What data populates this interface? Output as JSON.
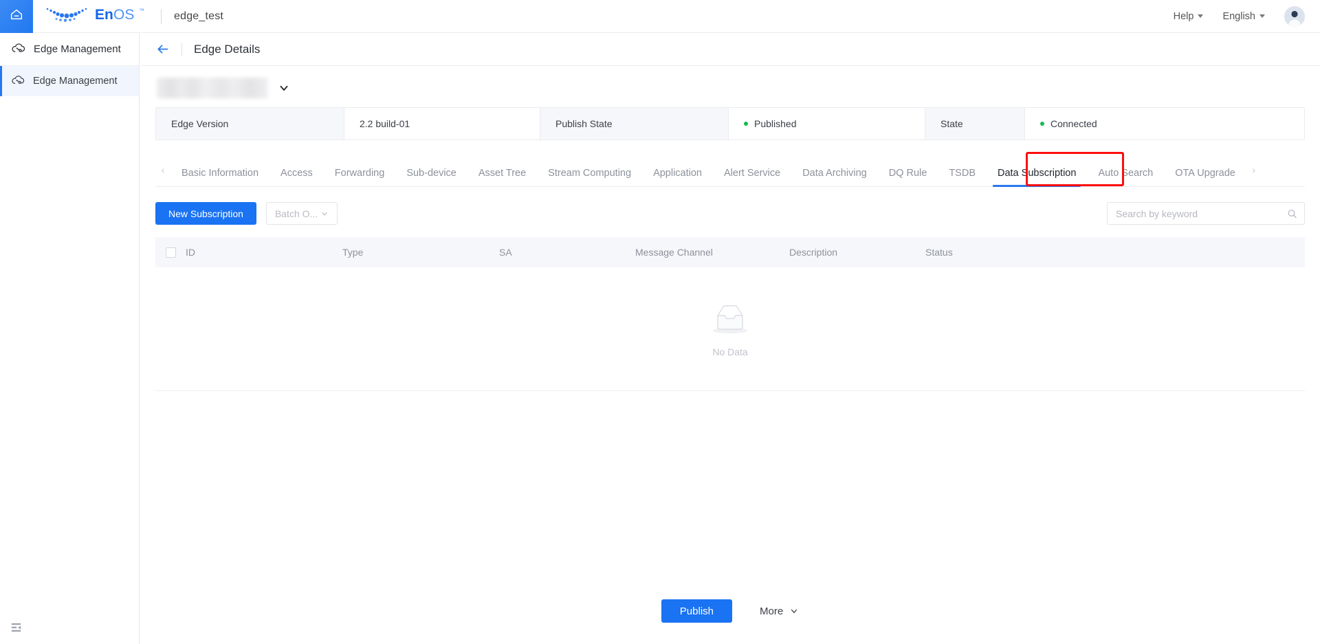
{
  "topbar": {
    "home_icon": "home-icon",
    "brand": "EnOS",
    "doc_title": "edge_test",
    "help_label": "Help",
    "language_label": "English",
    "avatar_icon": "user-avatar-icon"
  },
  "sidebar": {
    "header": {
      "label": "Edge Management",
      "icon": "edge-cloud-icon"
    },
    "items": [
      {
        "label": "Edge Management",
        "icon": "edge-cloud-icon",
        "selected": true
      }
    ],
    "collapse_icon": "sidebar-collapse-icon"
  },
  "page": {
    "back_icon": "back-arrow-icon",
    "title": "Edge Details"
  },
  "device_selector": {
    "value": "",
    "chevron_icon": "chevron-down-icon"
  },
  "info": {
    "cells": [
      {
        "label": "Edge Version",
        "value": "2.2 build-01",
        "status": null
      },
      {
        "label": "Publish State",
        "value": "Published",
        "status": "ok"
      },
      {
        "label": "State",
        "value": "Connected",
        "status": "ok"
      }
    ],
    "status_color": "#19b955"
  },
  "tabs": {
    "scroll_left_icon": "chevron-left-icon",
    "scroll_right_icon": "chevron-right-icon",
    "active": "Data Subscription",
    "highlight_color": "#fd0d0d",
    "accent_color": "#2878f0",
    "items": [
      "Basic Information",
      "Access",
      "Forwarding",
      "Sub-device",
      "Asset Tree",
      "Stream Computing",
      "Application",
      "Alert Service",
      "Data Archiving",
      "DQ Rule",
      "TSDB",
      "Data Subscription",
      "Auto Search",
      "OTA Upgrade"
    ]
  },
  "toolbar": {
    "new_subscription_label": "New Subscription",
    "batch_label": "Batch O...",
    "batch_chevron_icon": "chevron-down-icon",
    "search_placeholder": "Search by keyword",
    "search_value": "",
    "search_icon": "search-icon"
  },
  "table": {
    "select_all_checkbox": "select-all-checkbox",
    "columns": [
      "ID",
      "Type",
      "SA",
      "Message Channel",
      "Description",
      "Status"
    ],
    "rows": [],
    "empty_icon": "empty-inbox-icon",
    "empty_text": "No Data"
  },
  "footer": {
    "publish_label": "Publish",
    "more_label": "More",
    "more_chevron_icon": "chevron-down-icon"
  }
}
